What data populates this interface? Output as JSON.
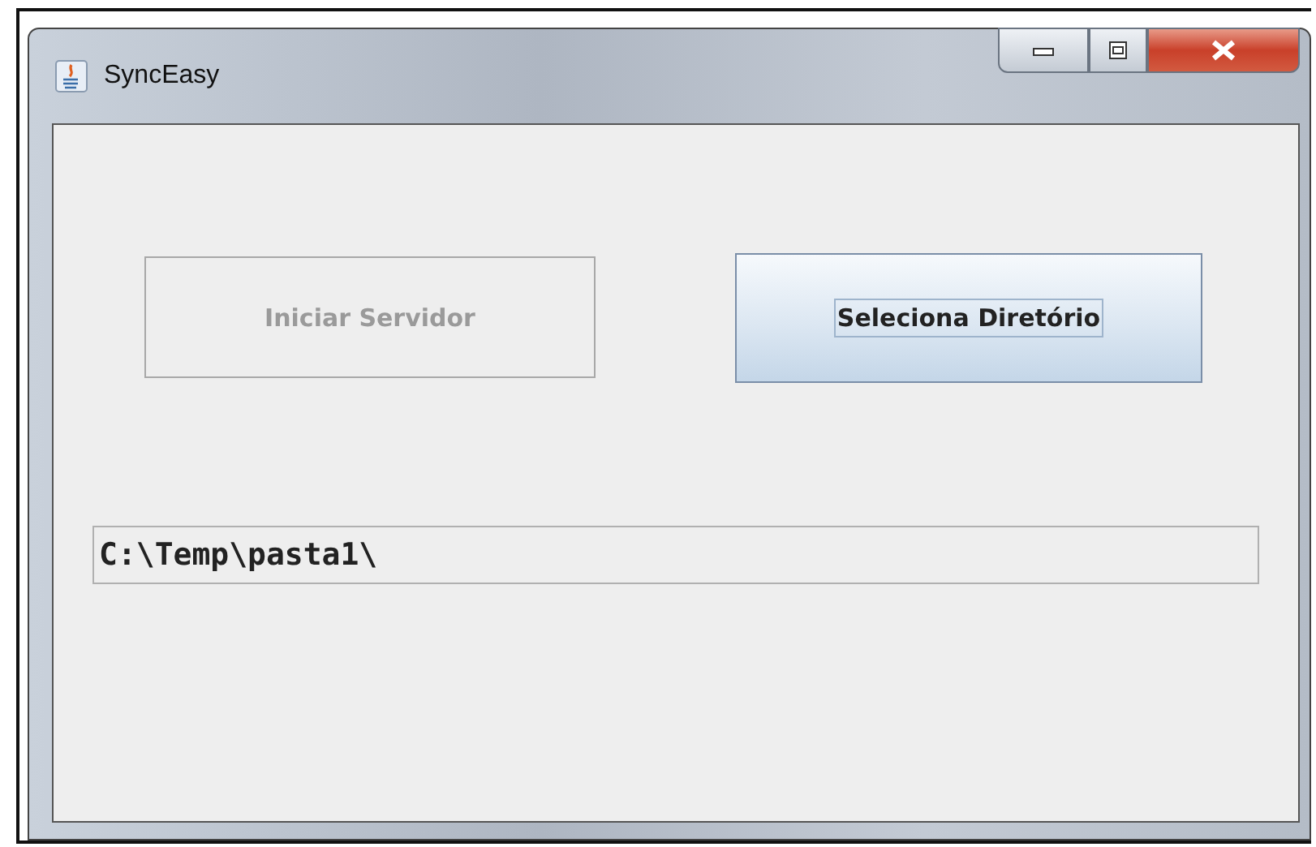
{
  "window": {
    "title": "SyncEasy"
  },
  "buttons": [
    {
      "label": "Iniciar Servidor",
      "disabled": true,
      "focused": false
    },
    {
      "label": "Seleciona Diretório",
      "disabled": false,
      "focused": true
    }
  ],
  "path_field": {
    "value": "C:\\Temp\\pasta1\\"
  }
}
